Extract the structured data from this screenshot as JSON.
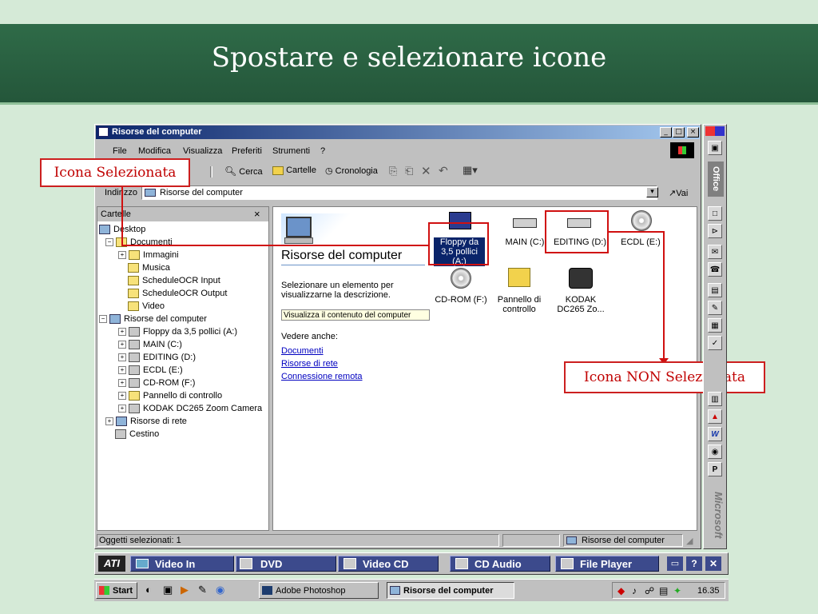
{
  "slide": {
    "title": "Spostare e selezionare icone"
  },
  "window": {
    "title": "Risorse del computer",
    "menu": [
      "File",
      "Modifica",
      "Visualizza",
      "Preferiti",
      "Strumenti",
      "?"
    ],
    "toolbar": {
      "cerca": "Cerca",
      "cartelle": "Cartelle",
      "cronologia": "Cronologia"
    },
    "address_label": "Indirizzo",
    "address_value": "Risorse del computer",
    "vai": "Vai",
    "folders_pane_title": "Cartelle",
    "tree": [
      "Desktop",
      "Documenti",
      "Immagini",
      "Musica",
      "ScheduleOCR Input",
      "ScheduleOCR Output",
      "Video",
      "Risorse del computer",
      "Floppy da 3,5 pollici (A:)",
      "MAIN (C:)",
      "EDITING (D:)",
      "ECDL (E:)",
      "CD-ROM (F:)",
      "Pannello di controllo",
      "KODAK DC265 Zoom Camera",
      "Risorse di rete",
      "Cestino"
    ],
    "info": {
      "heading": "Risorse del computer",
      "desc": "Selezionare un elemento per visualizzarne la descrizione.",
      "view_content": "Visualizza il contenuto del computer",
      "see_also": "Vedere anche:",
      "links": [
        "Documenti",
        "Risorse di rete",
        "Connessione remota"
      ]
    },
    "icons": {
      "floppy": "Floppy da 3,5 pollici (A:)",
      "main": "MAIN (C:)",
      "editing": "EDITING (D:)",
      "ecdl": "ECDL (E:)",
      "cdrom": "CD-ROM (F:)",
      "pannello": "Pannello di controllo",
      "kodak": "KODAK DC265 Zo..."
    },
    "status_left": "Oggetti selezionati: 1",
    "status_right": "Risorse del computer"
  },
  "callouts": {
    "selected": "Icona Selezionata",
    "not_selected": "Icona NON Selezionata"
  },
  "office_bar": {
    "label": "Office",
    "brand": "Microsoft"
  },
  "media_bar": {
    "ati": "ATI",
    "buttons": [
      "Video In",
      "DVD",
      "Video CD",
      "CD Audio",
      "File Player"
    ]
  },
  "taskbar": {
    "start": "Start",
    "tasks": [
      "Adobe Photoshop",
      "Risorse del computer"
    ],
    "clock": "16.35"
  }
}
